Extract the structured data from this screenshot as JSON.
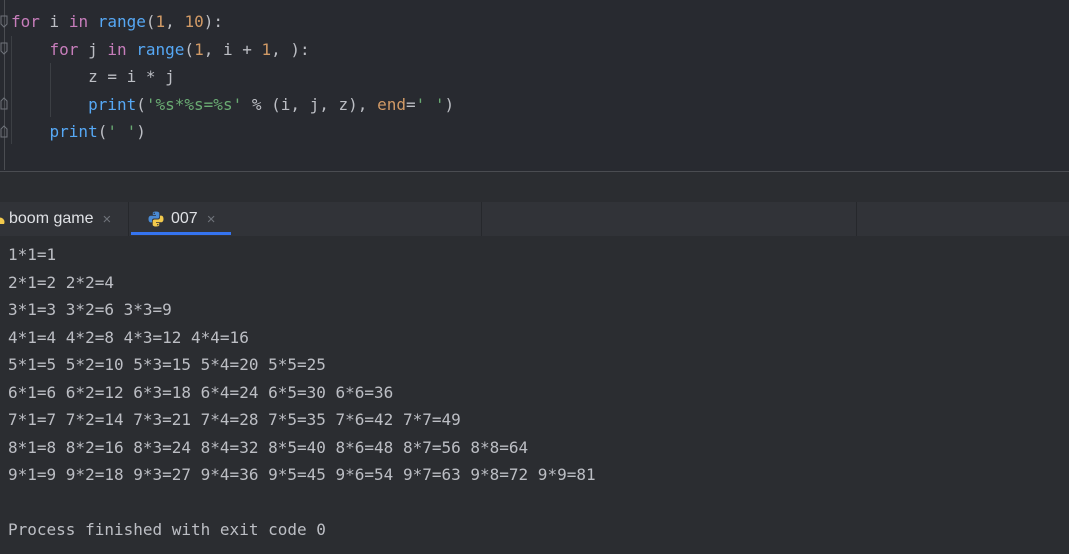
{
  "editor": {
    "lines": [
      {
        "tokens": [
          {
            "text": "for",
            "cls": "kw2"
          },
          {
            "text": " i ",
            "cls": ""
          },
          {
            "text": "in",
            "cls": "kw2"
          },
          {
            "text": " ",
            "cls": ""
          },
          {
            "text": "range",
            "cls": "builtin"
          },
          {
            "text": "(",
            "cls": ""
          },
          {
            "text": "1",
            "cls": "num2"
          },
          {
            "text": ", ",
            "cls": ""
          },
          {
            "text": "10",
            "cls": "num2"
          },
          {
            "text": "):",
            "cls": ""
          }
        ]
      },
      {
        "tokens": [
          {
            "text": "    ",
            "cls": ""
          },
          {
            "text": "for",
            "cls": "kw2"
          },
          {
            "text": " j ",
            "cls": ""
          },
          {
            "text": "in",
            "cls": "kw2"
          },
          {
            "text": " ",
            "cls": ""
          },
          {
            "text": "range",
            "cls": "builtin"
          },
          {
            "text": "(",
            "cls": ""
          },
          {
            "text": "1",
            "cls": "num2"
          },
          {
            "text": ", i + ",
            "cls": ""
          },
          {
            "text": "1",
            "cls": "num2"
          },
          {
            "text": ", ):",
            "cls": ""
          }
        ]
      },
      {
        "tokens": [
          {
            "text": "        z = i * j",
            "cls": ""
          }
        ]
      },
      {
        "tokens": [
          {
            "text": "        ",
            "cls": ""
          },
          {
            "text": "print",
            "cls": "builtin"
          },
          {
            "text": "(",
            "cls": ""
          },
          {
            "text": "'%s*%s=%s'",
            "cls": "str"
          },
          {
            "text": " % (i, j, z), ",
            "cls": ""
          },
          {
            "text": "end",
            "cls": "num2"
          },
          {
            "text": "=",
            "cls": ""
          },
          {
            "text": "' '",
            "cls": "str"
          },
          {
            "text": ")",
            "cls": ""
          }
        ]
      },
      {
        "tokens": [
          {
            "text": "    ",
            "cls": ""
          },
          {
            "text": "print",
            "cls": "builtin"
          },
          {
            "text": "(",
            "cls": ""
          },
          {
            "text": "' '",
            "cls": "str"
          },
          {
            "text": ")",
            "cls": ""
          }
        ]
      }
    ]
  },
  "tabs": [
    {
      "label": "boom game",
      "close": "×",
      "active": false
    },
    {
      "label": "007",
      "close": "×",
      "active": true
    }
  ],
  "colors": {
    "accent": "#3574f0",
    "background": "#2b2d31",
    "python_blue": "#4a8ad4",
    "python_yellow": "#f2c94c"
  },
  "console": {
    "lines": [
      "1*1=1",
      "2*1=2 2*2=4",
      "3*1=3 3*2=6 3*3=9",
      "4*1=4 4*2=8 4*3=12 4*4=16",
      "5*1=5 5*2=10 5*3=15 5*4=20 5*5=25",
      "6*1=6 6*2=12 6*3=18 6*4=24 6*5=30 6*6=36",
      "7*1=7 7*2=14 7*3=21 7*4=28 7*5=35 7*6=42 7*7=49",
      "8*1=8 8*2=16 8*3=24 8*4=32 8*5=40 8*6=48 8*7=56 8*8=64",
      "9*1=9 9*2=18 9*3=27 9*4=36 9*5=45 9*6=54 9*7=63 9*8=72 9*9=81",
      "",
      "Process finished with exit code 0"
    ]
  }
}
